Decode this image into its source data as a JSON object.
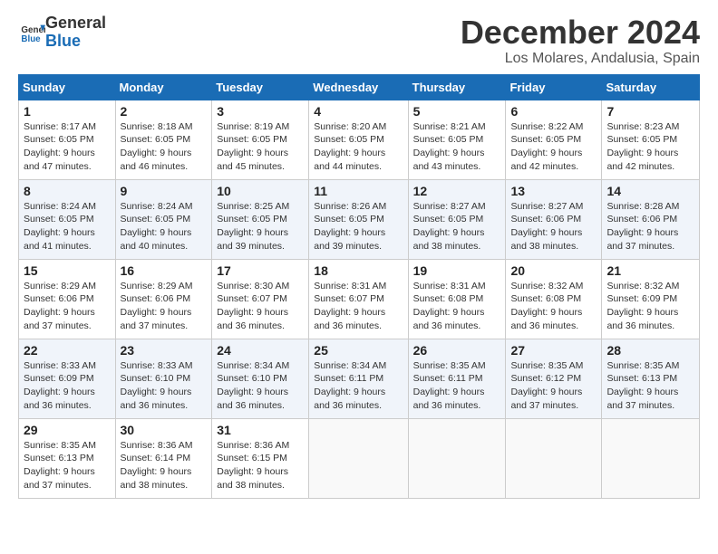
{
  "logo": {
    "line1": "General",
    "line2": "Blue"
  },
  "title": "December 2024",
  "location": "Los Molares, Andalusia, Spain",
  "headers": [
    "Sunday",
    "Monday",
    "Tuesday",
    "Wednesday",
    "Thursday",
    "Friday",
    "Saturday"
  ],
  "weeks": [
    [
      {
        "day": "1",
        "sunrise": "8:17 AM",
        "sunset": "6:05 PM",
        "daylight": "9 hours and 47 minutes."
      },
      {
        "day": "2",
        "sunrise": "8:18 AM",
        "sunset": "6:05 PM",
        "daylight": "9 hours and 46 minutes."
      },
      {
        "day": "3",
        "sunrise": "8:19 AM",
        "sunset": "6:05 PM",
        "daylight": "9 hours and 45 minutes."
      },
      {
        "day": "4",
        "sunrise": "8:20 AM",
        "sunset": "6:05 PM",
        "daylight": "9 hours and 44 minutes."
      },
      {
        "day": "5",
        "sunrise": "8:21 AM",
        "sunset": "6:05 PM",
        "daylight": "9 hours and 43 minutes."
      },
      {
        "day": "6",
        "sunrise": "8:22 AM",
        "sunset": "6:05 PM",
        "daylight": "9 hours and 42 minutes."
      },
      {
        "day": "7",
        "sunrise": "8:23 AM",
        "sunset": "6:05 PM",
        "daylight": "9 hours and 42 minutes."
      }
    ],
    [
      {
        "day": "8",
        "sunrise": "8:24 AM",
        "sunset": "6:05 PM",
        "daylight": "9 hours and 41 minutes."
      },
      {
        "day": "9",
        "sunrise": "8:24 AM",
        "sunset": "6:05 PM",
        "daylight": "9 hours and 40 minutes."
      },
      {
        "day": "10",
        "sunrise": "8:25 AM",
        "sunset": "6:05 PM",
        "daylight": "9 hours and 39 minutes."
      },
      {
        "day": "11",
        "sunrise": "8:26 AM",
        "sunset": "6:05 PM",
        "daylight": "9 hours and 39 minutes."
      },
      {
        "day": "12",
        "sunrise": "8:27 AM",
        "sunset": "6:05 PM",
        "daylight": "9 hours and 38 minutes."
      },
      {
        "day": "13",
        "sunrise": "8:27 AM",
        "sunset": "6:06 PM",
        "daylight": "9 hours and 38 minutes."
      },
      {
        "day": "14",
        "sunrise": "8:28 AM",
        "sunset": "6:06 PM",
        "daylight": "9 hours and 37 minutes."
      }
    ],
    [
      {
        "day": "15",
        "sunrise": "8:29 AM",
        "sunset": "6:06 PM",
        "daylight": "9 hours and 37 minutes."
      },
      {
        "day": "16",
        "sunrise": "8:29 AM",
        "sunset": "6:06 PM",
        "daylight": "9 hours and 37 minutes."
      },
      {
        "day": "17",
        "sunrise": "8:30 AM",
        "sunset": "6:07 PM",
        "daylight": "9 hours and 36 minutes."
      },
      {
        "day": "18",
        "sunrise": "8:31 AM",
        "sunset": "6:07 PM",
        "daylight": "9 hours and 36 minutes."
      },
      {
        "day": "19",
        "sunrise": "8:31 AM",
        "sunset": "6:08 PM",
        "daylight": "9 hours and 36 minutes."
      },
      {
        "day": "20",
        "sunrise": "8:32 AM",
        "sunset": "6:08 PM",
        "daylight": "9 hours and 36 minutes."
      },
      {
        "day": "21",
        "sunrise": "8:32 AM",
        "sunset": "6:09 PM",
        "daylight": "9 hours and 36 minutes."
      }
    ],
    [
      {
        "day": "22",
        "sunrise": "8:33 AM",
        "sunset": "6:09 PM",
        "daylight": "9 hours and 36 minutes."
      },
      {
        "day": "23",
        "sunrise": "8:33 AM",
        "sunset": "6:10 PM",
        "daylight": "9 hours and 36 minutes."
      },
      {
        "day": "24",
        "sunrise": "8:34 AM",
        "sunset": "6:10 PM",
        "daylight": "9 hours and 36 minutes."
      },
      {
        "day": "25",
        "sunrise": "8:34 AM",
        "sunset": "6:11 PM",
        "daylight": "9 hours and 36 minutes."
      },
      {
        "day": "26",
        "sunrise": "8:35 AM",
        "sunset": "6:11 PM",
        "daylight": "9 hours and 36 minutes."
      },
      {
        "day": "27",
        "sunrise": "8:35 AM",
        "sunset": "6:12 PM",
        "daylight": "9 hours and 37 minutes."
      },
      {
        "day": "28",
        "sunrise": "8:35 AM",
        "sunset": "6:13 PM",
        "daylight": "9 hours and 37 minutes."
      }
    ],
    [
      {
        "day": "29",
        "sunrise": "8:35 AM",
        "sunset": "6:13 PM",
        "daylight": "9 hours and 37 minutes."
      },
      {
        "day": "30",
        "sunrise": "8:36 AM",
        "sunset": "6:14 PM",
        "daylight": "9 hours and 38 minutes."
      },
      {
        "day": "31",
        "sunrise": "8:36 AM",
        "sunset": "6:15 PM",
        "daylight": "9 hours and 38 minutes."
      },
      null,
      null,
      null,
      null
    ]
  ]
}
